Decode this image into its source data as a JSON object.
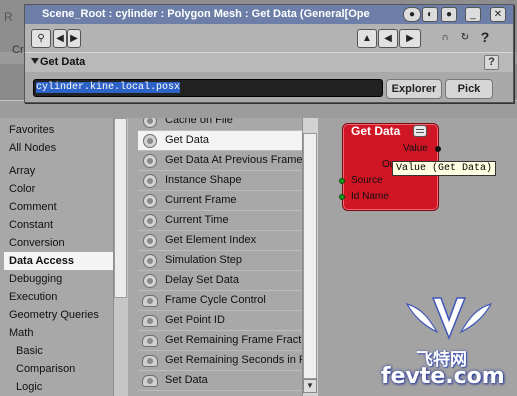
{
  "background": {
    "app_title_fragment": "R",
    "tab_fragment": "Cr"
  },
  "window": {
    "title": "Scene_Root : cylinder : Polygon Mesh : Get Data (General[Ope",
    "section_title": "Get Data",
    "expression_value": "cylinder.kine.local.posx",
    "buttons": {
      "explorer": "Explorer",
      "pick": "Pick",
      "help": "?"
    },
    "toolbar_glyphs": {
      "nav_prev": "◀",
      "nav_next": "▶",
      "help": "?"
    }
  },
  "categories": [
    {
      "label": "Favorites"
    },
    {
      "label": "All Nodes"
    },
    {
      "label": "Array"
    },
    {
      "label": "Color"
    },
    {
      "label": "Comment"
    },
    {
      "label": "Constant"
    },
    {
      "label": "Conversion"
    },
    {
      "label": "Data Access",
      "selected": true
    },
    {
      "label": "Debugging"
    },
    {
      "label": "Execution"
    },
    {
      "label": "Geometry Queries"
    },
    {
      "label": "Math"
    },
    {
      "label": "Basic",
      "sub": true
    },
    {
      "label": "Comparison",
      "sub": true
    },
    {
      "label": "Logic",
      "sub": true
    }
  ],
  "nodes": [
    {
      "label": "Cache on File",
      "icon": "gear-icon"
    },
    {
      "label": "Get Data",
      "icon": "gear-icon",
      "selected": true
    },
    {
      "label": "Get Data At Previous Frame",
      "icon": "gear-icon"
    },
    {
      "label": "Instance Shape",
      "icon": "gear-icon"
    },
    {
      "label": "Current Frame",
      "icon": "gear-icon"
    },
    {
      "label": "Current Time",
      "icon": "gear-icon"
    },
    {
      "label": "Get Element Index",
      "icon": "gear-icon"
    },
    {
      "label": "Simulation Step",
      "icon": "gear-icon"
    },
    {
      "label": "Delay Set Data",
      "icon": "gear-icon"
    },
    {
      "label": "Frame Cycle Control",
      "icon": "cloud-icon"
    },
    {
      "label": "Get Point ID",
      "icon": "cloud-icon"
    },
    {
      "label": "Get Remaining Frame Fractio",
      "icon": "cloud-icon"
    },
    {
      "label": "Get Remaining Seconds in Fra",
      "icon": "cloud-icon"
    },
    {
      "label": "Set Data",
      "icon": "cloud-icon"
    }
  ],
  "graph_node": {
    "title": "Get Data",
    "out_value": "Value",
    "out_fragment": "Ou",
    "in_source": "Source",
    "in_idname": "Id Name",
    "tooltip": "Value (Get Data)",
    "color": "#d01525"
  },
  "watermark": {
    "cn": "飞特网",
    "en": "fevte.com"
  }
}
